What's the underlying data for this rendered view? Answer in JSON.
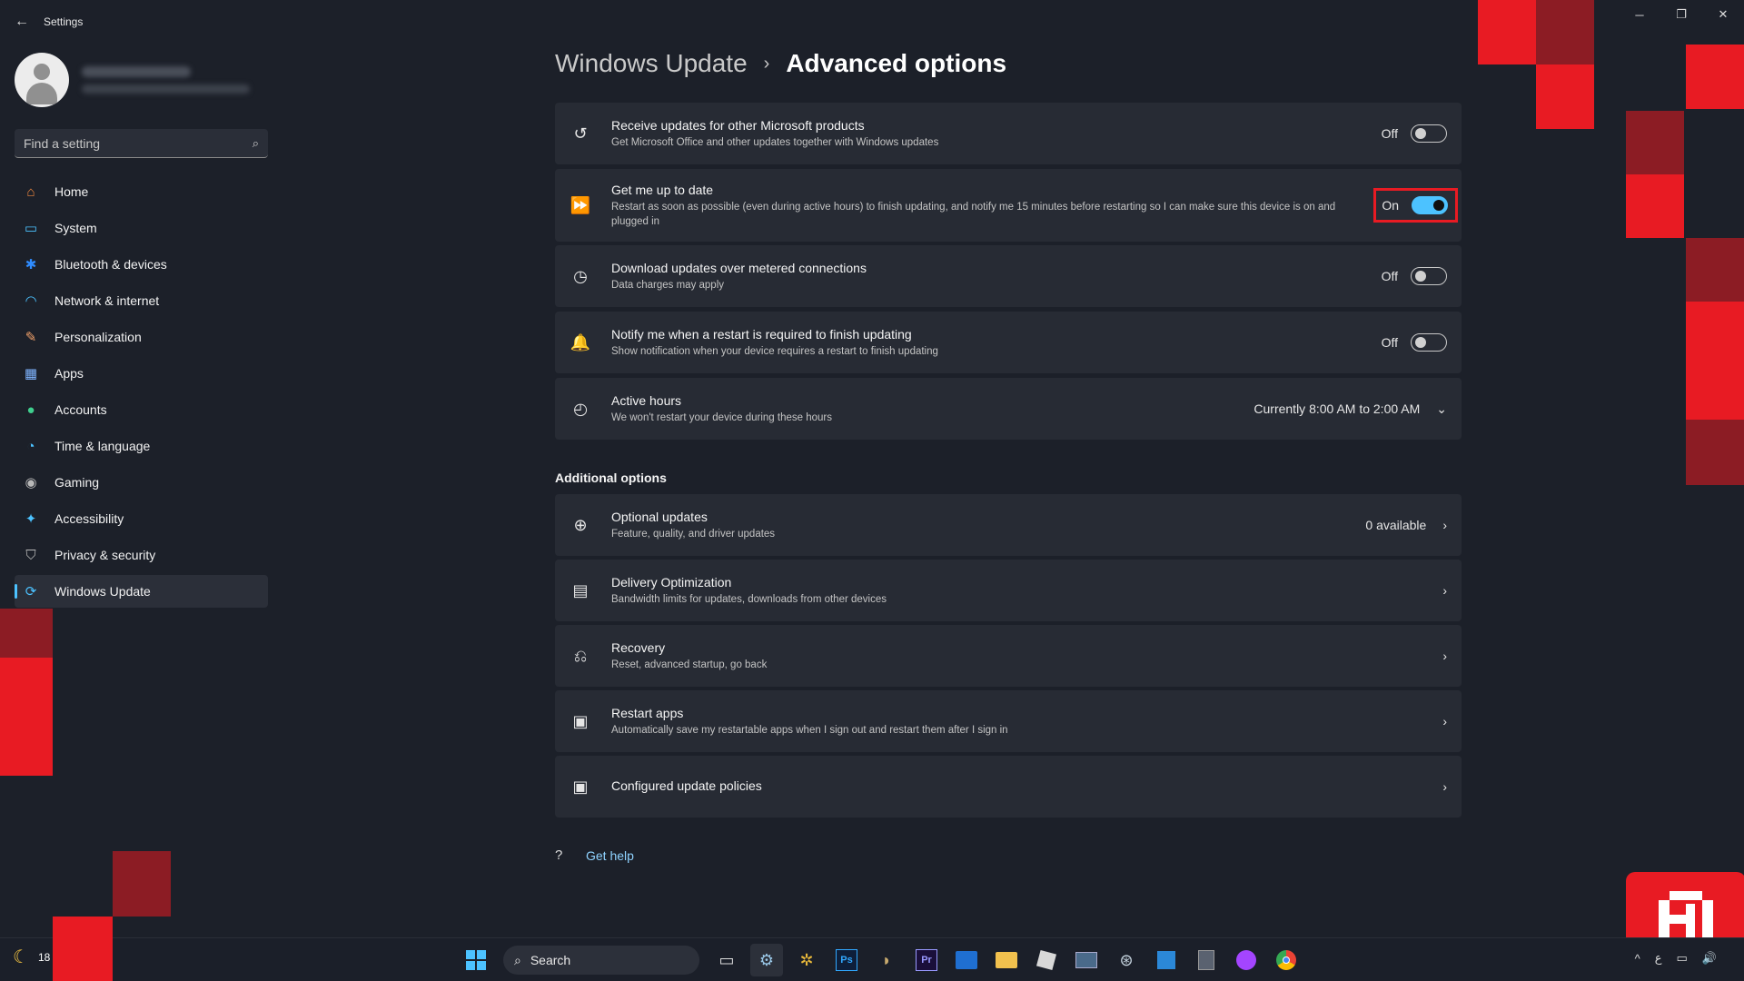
{
  "window": {
    "title": "Settings",
    "back_glyph": "←",
    "minimize_glyph": "─",
    "maximize_glyph": "❐",
    "close_glyph": "✕"
  },
  "sidebar": {
    "search_placeholder": "Find a setting",
    "items": [
      {
        "label": "Home",
        "icon": "home-icon",
        "glyph": "⌂",
        "color": "#f0883e"
      },
      {
        "label": "System",
        "icon": "system-icon",
        "glyph": "▭",
        "color": "#4cc2ff"
      },
      {
        "label": "Bluetooth & devices",
        "icon": "bluetooth-icon",
        "glyph": "✱",
        "color": "#2f8cff"
      },
      {
        "label": "Network & internet",
        "icon": "wifi-icon",
        "glyph": "◠",
        "color": "#4cc2ff"
      },
      {
        "label": "Personalization",
        "icon": "brush-icon",
        "glyph": "✎",
        "color": "#f3a26a"
      },
      {
        "label": "Apps",
        "icon": "apps-icon",
        "glyph": "▦",
        "color": "#7fb4ff"
      },
      {
        "label": "Accounts",
        "icon": "accounts-icon",
        "glyph": "●",
        "color": "#3fcf8e"
      },
      {
        "label": "Time & language",
        "icon": "globe-icon",
        "glyph": "◔",
        "color": "#4cc2ff"
      },
      {
        "label": "Gaming",
        "icon": "gamepad-icon",
        "glyph": "◉",
        "color": "#b8b8b8"
      },
      {
        "label": "Accessibility",
        "icon": "accessibility-icon",
        "glyph": "✦",
        "color": "#4cc2ff"
      },
      {
        "label": "Privacy & security",
        "icon": "shield-icon",
        "glyph": "⛉",
        "color": "#b8b8b8"
      },
      {
        "label": "Windows Update",
        "icon": "update-icon",
        "glyph": "⟳",
        "color": "#4cc2ff",
        "active": true
      }
    ]
  },
  "breadcrumb": {
    "parent": "Windows Update",
    "separator": "›",
    "current": "Advanced options"
  },
  "settings": [
    {
      "title": "Receive updates for other Microsoft products",
      "desc": "Get Microsoft Office and other updates together with Windows updates",
      "state": "Off",
      "icon": "refresh-icon",
      "glyph": "↺"
    },
    {
      "title": "Get me up to date",
      "desc": "Restart as soon as possible (even during active hours) to finish updating, and notify me 15 minutes before restarting so I can make sure this device is on and plugged in",
      "state": "On",
      "icon": "fast-forward-icon",
      "glyph": "⏩"
    },
    {
      "title": "Download updates over metered connections",
      "desc": "Data charges may apply",
      "state": "Off",
      "icon": "gauge-icon",
      "glyph": "◷"
    },
    {
      "title": "Notify me when a restart is required to finish updating",
      "desc": "Show notification when your device requires a restart to finish updating",
      "state": "Off",
      "icon": "bell-icon",
      "glyph": "🔔"
    },
    {
      "title": "Active hours",
      "desc": "We won't restart your device during these hours",
      "value": "Currently 8:00 AM to 2:00 AM",
      "icon": "clock-icon",
      "glyph": "◴"
    }
  ],
  "additional": {
    "heading": "Additional options",
    "items": [
      {
        "title": "Optional updates",
        "desc": "Feature, quality, and driver updates",
        "value": "0 available",
        "icon": "plus-circle-icon",
        "glyph": "⊕"
      },
      {
        "title": "Delivery Optimization",
        "desc": "Bandwidth limits for updates, downloads from other devices",
        "value": "",
        "icon": "delivery-icon",
        "glyph": "▤"
      },
      {
        "title": "Recovery",
        "desc": "Reset, advanced startup, go back",
        "value": "",
        "icon": "recovery-icon",
        "glyph": "⎌"
      },
      {
        "title": "Restart apps",
        "desc": "Automatically save my restartable apps when I sign out and restart them after I sign in",
        "value": "",
        "icon": "restart-apps-icon",
        "glyph": "▣"
      },
      {
        "title": "Configured update policies",
        "desc": "",
        "value": "",
        "icon": "policy-icon",
        "glyph": "▣"
      }
    ]
  },
  "help": {
    "label": "Get help",
    "glyph": "?"
  },
  "glyphs": {
    "chevron_right": "›",
    "chevron_down": "⌄",
    "search": "⌕"
  },
  "taskbar": {
    "search_label": "Search",
    "weather": "18",
    "tray": [
      "^",
      "ع",
      "▭",
      "🔊"
    ]
  },
  "colors": {
    "accent": "#4cc2ff",
    "highlight": "#e81b23",
    "background": "#1c2029",
    "card": "#272b34"
  }
}
